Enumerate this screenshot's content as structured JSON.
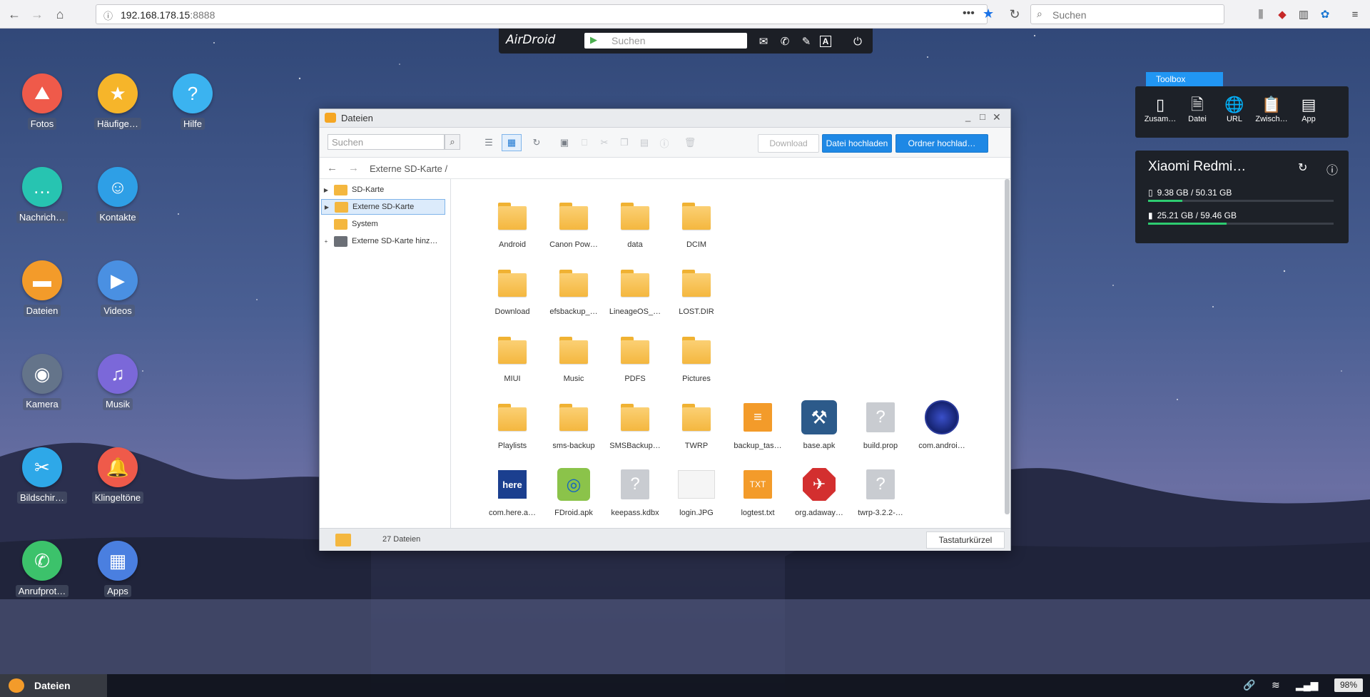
{
  "browser": {
    "url_host": "192.168.178.15",
    "url_port": ":8888",
    "search_placeholder": "Suchen"
  },
  "airdroid": {
    "logo": "AirDroid",
    "search_placeholder": "Suchen"
  },
  "desktop_icons": [
    {
      "label": "Fotos",
      "icon": "photos-icon",
      "color": "#ef5a4a"
    },
    {
      "label": "Häufige…",
      "icon": "favorites-icon",
      "color": "#f6b52a"
    },
    {
      "label": "Hilfe",
      "icon": "help-icon",
      "color": "#3bb3f0"
    },
    {
      "label": "Nachrich…",
      "icon": "messages-icon",
      "color": "#27c4b1"
    },
    {
      "label": "Kontakte",
      "icon": "contacts-icon",
      "color": "#2e9fe6"
    },
    {
      "label": "Dateien",
      "icon": "files-icon",
      "color": "#f39b2a"
    },
    {
      "label": "Videos",
      "icon": "videos-icon",
      "color": "#4a90e2"
    },
    {
      "label": "Kamera",
      "icon": "camera-icon",
      "color": "#64748a"
    },
    {
      "label": "Musik",
      "icon": "music-icon",
      "color": "#7b68d9"
    },
    {
      "label": "Bildschir…",
      "icon": "screenshot-icon",
      "color": "#2ea8e8"
    },
    {
      "label": "Klingeltöne",
      "icon": "ringtones-icon",
      "color": "#ef5a4a"
    },
    {
      "label": "Anrufprot…",
      "icon": "call-log-icon",
      "color": "#3cc26b"
    },
    {
      "label": "Apps",
      "icon": "apps-icon",
      "color": "#4a7fe0"
    }
  ],
  "window": {
    "title": "Dateien",
    "search_placeholder": "Suchen",
    "download_label": "Download",
    "upload_file_label": "Datei hochladen",
    "upload_folder_label": "Ordner hochlad…",
    "breadcrumb": "Externe SD-Karte",
    "breadcrumb_sep": "/",
    "tree": [
      {
        "label": "SD-Karte",
        "expander": "▶",
        "selected": false
      },
      {
        "label": "Externe SD-Karte",
        "expander": "▶",
        "selected": true
      },
      {
        "label": "System",
        "expander": "",
        "selected": false
      },
      {
        "label": "Externe SD-Karte hinz…",
        "expander": "+",
        "selected": false
      }
    ],
    "items": [
      {
        "name": "Android",
        "kind": "folder"
      },
      {
        "name": "Canon Pow…",
        "kind": "folder"
      },
      {
        "name": "data",
        "kind": "folder"
      },
      {
        "name": "DCIM",
        "kind": "folder"
      },
      {
        "name": "Download",
        "kind": "folder"
      },
      {
        "name": "efsbackup_…",
        "kind": "folder"
      },
      {
        "name": "LineageOS_…",
        "kind": "folder"
      },
      {
        "name": "LOST.DIR",
        "kind": "folder"
      },
      {
        "name": "MIUI",
        "kind": "folder"
      },
      {
        "name": "Music",
        "kind": "folder"
      },
      {
        "name": "PDFS",
        "kind": "folder"
      },
      {
        "name": "Pictures",
        "kind": "folder"
      },
      {
        "name": "Playlists",
        "kind": "folder"
      },
      {
        "name": "sms-backup",
        "kind": "folder"
      },
      {
        "name": "SMSBackup…",
        "kind": "folder"
      },
      {
        "name": "TWRP",
        "kind": "folder"
      },
      {
        "name": "backup_tas…",
        "kind": "doc"
      },
      {
        "name": "base.apk",
        "kind": "apk"
      },
      {
        "name": "build.prop",
        "kind": "unknown"
      },
      {
        "name": "com.androi…",
        "kind": "radar"
      },
      {
        "name": "com.here.a…",
        "kind": "here",
        "badge": "here"
      },
      {
        "name": "FDroid.apk",
        "kind": "fdroid"
      },
      {
        "name": "keepass.kdbx",
        "kind": "unknown"
      },
      {
        "name": "login.JPG",
        "kind": "jpg"
      },
      {
        "name": "logtest.txt",
        "kind": "txt",
        "badge": "TXT"
      },
      {
        "name": "org.adaway…",
        "kind": "adaway"
      },
      {
        "name": "twrp-3.2.2-…",
        "kind": "unknown"
      }
    ],
    "status_count": "27 Dateien",
    "shortcuts_label": "Tastaturkürzel"
  },
  "toolbox": {
    "tab_label": "Toolbox",
    "items": [
      {
        "label": "Zusam…",
        "icon": "phone-icon"
      },
      {
        "label": "Datei",
        "icon": "file-icon"
      },
      {
        "label": "URL",
        "icon": "globe-icon"
      },
      {
        "label": "Zwisch…",
        "icon": "clipboard-icon"
      },
      {
        "label": "App",
        "icon": "app-box-icon"
      }
    ],
    "device_name": "Xiaomi Redmi…",
    "storage": [
      {
        "text": "9.38 GB / 50.31 GB",
        "fraction": 0.186,
        "icon": "phone-storage-icon"
      },
      {
        "text": "25.21 GB / 59.46 GB",
        "fraction": 0.424,
        "icon": "sdcard-storage-icon"
      }
    ]
  },
  "taskbar": {
    "active_label": "Dateien",
    "battery": "98%"
  },
  "colors": {
    "accent": "#1e88e5",
    "folder": "#f4b73f",
    "storage_bar": "#2ecc71"
  }
}
